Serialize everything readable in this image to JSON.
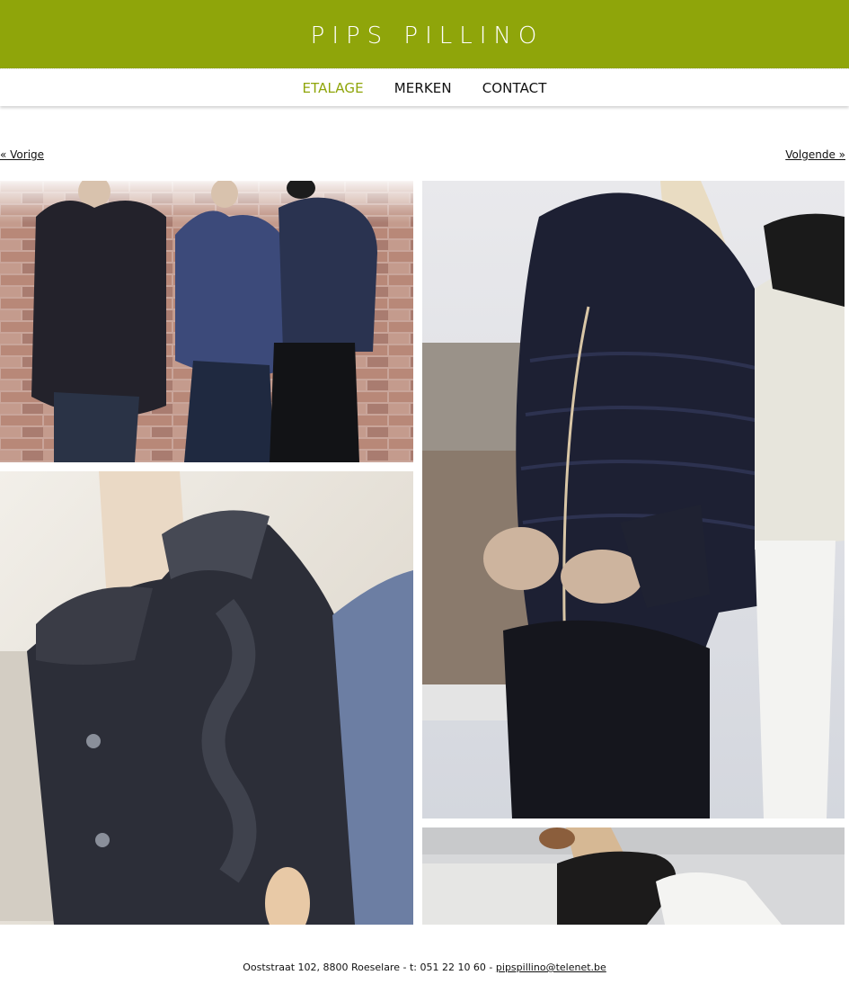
{
  "header": {
    "logo_text": "PIPS PILLINO",
    "background_color": "#8fa50a"
  },
  "nav": {
    "items": [
      {
        "label": "ETALAGE",
        "active": true
      },
      {
        "label": "MERKEN",
        "active": false
      },
      {
        "label": "CONTACT",
        "active": false
      }
    ],
    "active_color": "#8fa50a"
  },
  "pager": {
    "prev_label": "« Vorige",
    "next_label": "Volgende »"
  },
  "gallery": {
    "photos": [
      {
        "subject": "three-mannequins-brick-wall"
      },
      {
        "subject": "grey-knit-cardigan-fur-collar"
      },
      {
        "subject": "navy-puffer-jacket-fur-trim"
      },
      {
        "subject": "black-knit-scarf-white-jacket"
      }
    ]
  },
  "footer": {
    "address": "Ooststraat 102, 8800 Roeselare - t: 051 22 10 60 - ",
    "email": "pipspillino@telenet.be"
  }
}
